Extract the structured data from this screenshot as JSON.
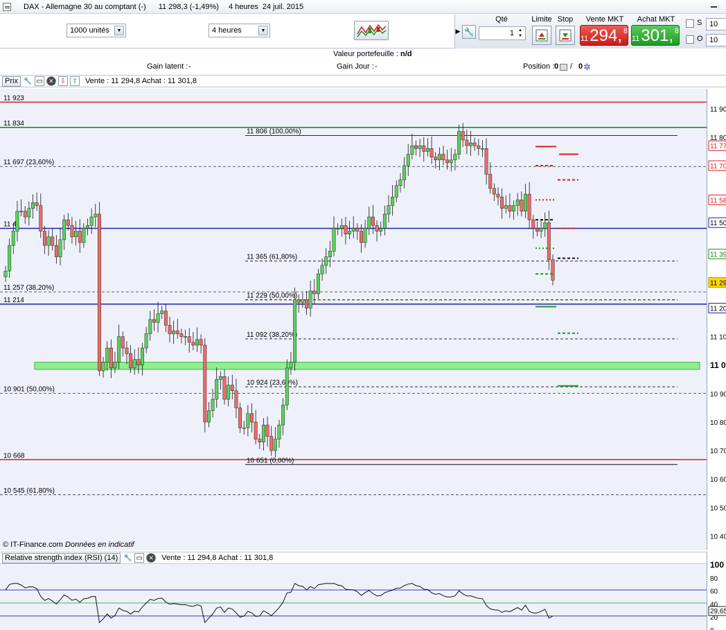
{
  "window": {
    "title": "DAX - Allemagne 30 au comptant (-)",
    "last_quote": "11 298,3 (-1,49%)",
    "timeframe": "4 heures",
    "date": "24 juil. 2015"
  },
  "toolbar": {
    "units_select": "1000 unités",
    "period_select": "4 heures",
    "chart_type_icon": "candlestick-chart-icon"
  },
  "order_panel": {
    "qty_label": "Qté",
    "qty_value": "1",
    "limit_label": "Limite",
    "stop_label": "Stop",
    "sell_label": "Vente MKT",
    "buy_label": "Achat MKT",
    "sell_price": {
      "prefix": "11",
      "main": "294,",
      "sup": "8"
    },
    "buy_price": {
      "prefix": "11",
      "main": "301,",
      "sup": "8"
    },
    "s_label": "S",
    "o_label": "O",
    "s_value": "10",
    "o_value": "10"
  },
  "portfolio": {
    "value_label": "Valeur portefeuille :",
    "value": "n/d",
    "latent_label": "Gain latent :",
    "latent_value": "-",
    "day_label": "Gain Jour :",
    "day_value": "-",
    "position_label": "Position :",
    "position_value": "0",
    "position_value2": "0"
  },
  "price_panel": {
    "tab": "Prix",
    "quote_text": "Vente : 11 294,8 Achat : 11 301,8",
    "copyright": "© IT-Finance.com",
    "disclaimer": "Données en indicatif",
    "line_labels": [
      "11 923",
      "11 834",
      "11 697 (23,60%)",
      "11 4",
      "11 257 (38,20%)",
      "11 214",
      "10 901 (50,00%)",
      "10 668",
      "10 545 (61,80%)"
    ],
    "fib_labels": [
      "11 806 (100,00%)",
      "11 365 (61,80%)",
      "11 229 (50,00%)",
      "11 092 (38,20%)",
      "10 924 (23,60%)",
      "10 651 (0,00%)"
    ],
    "axis_labels": [
      "11 90",
      "11 80",
      "11 77",
      "11 70",
      "11 58",
      "11 50",
      "11 39",
      "11 30",
      "11 29",
      "11 20",
      "11 10",
      "11 0",
      "10 90",
      "10 80",
      "10 70",
      "10 60",
      "10 50",
      "10 40"
    ]
  },
  "rsi_panel": {
    "title": "Relative strength index (RSI) (14)",
    "quote_text": "Vente : 11 294,8 Achat : 11 301,8",
    "axis_labels": [
      "100",
      "80",
      "60",
      "40",
      "20",
      "0"
    ],
    "current_value": "29,65"
  },
  "chart_data": [
    {
      "type": "candlestick",
      "title": "DAX - Allemagne 30 au comptant (-)",
      "ylim": [
        10350,
        11970
      ],
      "horizontal_lines": [
        11923,
        11834,
        11697,
        11480,
        11257,
        11214,
        10901,
        10668,
        10545
      ],
      "fibonacci": [
        {
          "level": "100,00%",
          "value": 11806
        },
        {
          "level": "61,80%",
          "value": 11365
        },
        {
          "level": "50,00%",
          "value": 11229
        },
        {
          "level": "38,20%",
          "value": 11092
        },
        {
          "level": "23,60%",
          "value": 10924
        },
        {
          "level": "0,00%",
          "value": 10651
        }
      ],
      "support_zone": [
        10985,
        11010
      ],
      "close": [
        11330,
        11420,
        11470,
        11540,
        11540,
        11520,
        11550,
        11570,
        11560,
        11470,
        11420,
        11450,
        11420,
        11380,
        11440,
        11510,
        11490,
        11450,
        11470,
        11430,
        11480,
        11490,
        11520,
        11530,
        10980,
        11010,
        11060,
        10990,
        11010,
        11100,
        11060,
        11040,
        10990,
        11020,
        11000,
        11060,
        11110,
        11160,
        11150,
        11180,
        11190,
        11140,
        11110,
        11120,
        11110,
        11100,
        11100,
        11080,
        11070,
        11090,
        11070,
        10800,
        10840,
        10880,
        10950,
        10960,
        10880,
        10930,
        10910,
        10850,
        10780,
        10780,
        10830,
        10800,
        10740,
        10730,
        10790,
        10750,
        10700,
        10740,
        10790,
        10860,
        10990,
        11010,
        11230,
        11220,
        11230,
        11200,
        11260,
        11250,
        11320,
        11350,
        11380,
        11400,
        11480,
        11480,
        11490,
        11460,
        11470,
        11480,
        11470,
        11430,
        11480,
        11520,
        11490,
        11470,
        11480,
        11530,
        11560,
        11590,
        11630,
        11650,
        11700,
        11740,
        11770,
        11760,
        11770,
        11750,
        11760,
        11730,
        11720,
        11740,
        11720,
        11710,
        11720,
        11740,
        11820,
        11790,
        11770,
        11780,
        11770,
        11760,
        11760,
        11670,
        11620,
        11600,
        11590,
        11550,
        11560,
        11540,
        11560,
        11580,
        11540,
        11600,
        11510,
        11480,
        11470,
        11480,
        11500,
        11370,
        11298
      ],
      "rsi": {
        "period": 14,
        "levels": [
          70,
          50,
          30
        ],
        "current": 29.65
      }
    }
  ]
}
